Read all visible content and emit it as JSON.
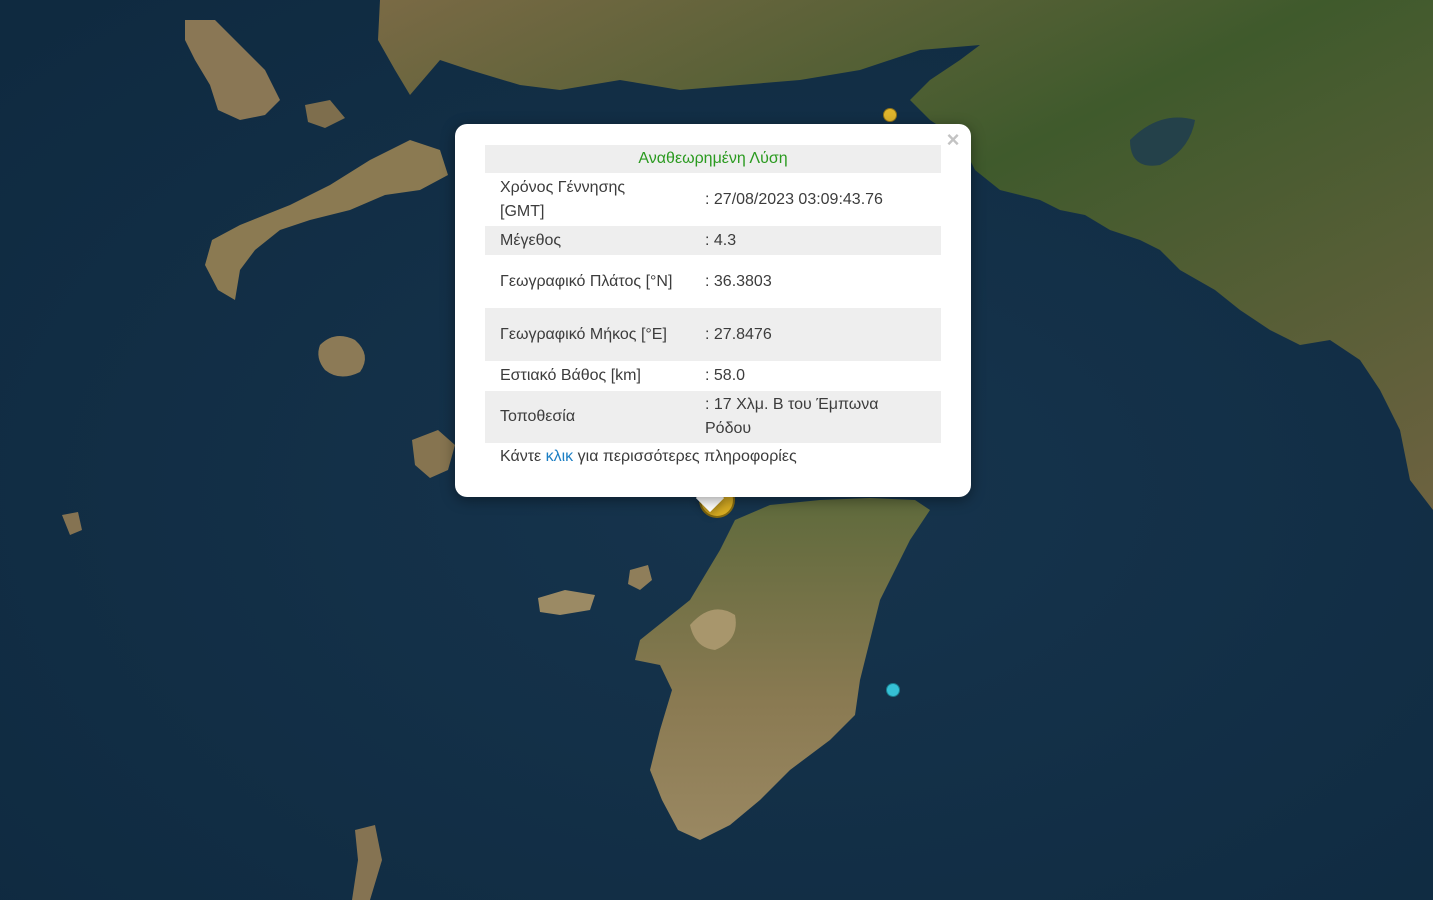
{
  "map": {
    "type": "satellite",
    "colors": {
      "sea": "#123049",
      "land": "#8d7a55",
      "vegetation": "#3e5a2c",
      "lake": "#24414a"
    }
  },
  "markers": [
    {
      "id": "quake-north",
      "color": "#e0b52c",
      "icon": "earthquake-marker-icon"
    },
    {
      "id": "quake-east",
      "color": "#35c1d6",
      "icon": "earthquake-marker-icon"
    },
    {
      "id": "quake-selected",
      "color": "#d8ad23",
      "icon": "earthquake-marker-icon"
    }
  ],
  "popup": {
    "title": "Αναθεωρημένη Λύση",
    "title_color": "#2a9a1f",
    "close_icon": "×",
    "rows": [
      {
        "label": "Χρόνος Γέννησης [GMT]",
        "value": ": 27/08/2023 03:09:43.76"
      },
      {
        "label": "Μέγεθος",
        "value": ": 4.3"
      },
      {
        "label": "Γεωγραφικό Πλάτος [°N]",
        "value": ": 36.3803"
      },
      {
        "label": "Γεωγραφικό Μήκος [°E]",
        "value": ": 27.8476"
      },
      {
        "label": "Εστιακό Βάθος [km]",
        "value": ": 58.0"
      },
      {
        "label": "Τοποθεσία",
        "value": ": 17 Χλμ. Β του Έμπωνα Ρόδου"
      }
    ],
    "more": {
      "prefix": "Κάντε ",
      "link": "κλικ",
      "suffix": " για περισσότερες πληροφορίες",
      "link_color": "#1c7fc4"
    }
  }
}
